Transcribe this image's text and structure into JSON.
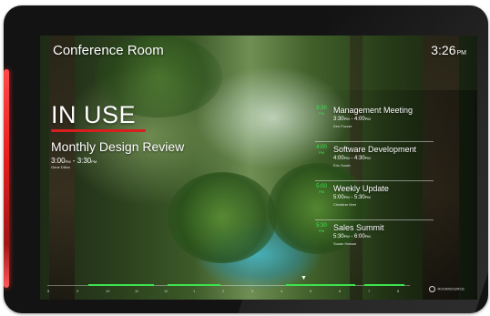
{
  "room": {
    "name": "Conference Room"
  },
  "clock": {
    "time": "3:26",
    "ampm": "PM"
  },
  "status": {
    "label": "IN USE",
    "color": "#d81e1e"
  },
  "current_meeting": {
    "title": "Monthly Design Review",
    "start": "3:00",
    "start_ampm": "PM",
    "end": "3:30",
    "end_ampm": "PM",
    "host": "Gene Dillon"
  },
  "agenda": [
    {
      "badge_line1": "PM",
      "badge_num": "3:30",
      "title": "Management Meeting",
      "start": "3:30",
      "start_ampm": "PM",
      "end": "4:00",
      "end_ampm": "PM",
      "host": "Ken Fozzer"
    },
    {
      "badge_line1": "PM",
      "badge_num": "4:00",
      "title": "Software Development",
      "start": "4:00",
      "start_ampm": "PM",
      "end": "4:30",
      "end_ampm": "PM",
      "host": "Eric Sorah"
    },
    {
      "badge_line1": "PM",
      "badge_num": "5:00",
      "title": "Weekly Update",
      "start": "5:00",
      "start_ampm": "PM",
      "end": "5:30",
      "end_ampm": "PM",
      "host": "Christina Veer"
    },
    {
      "badge_line1": "PM",
      "badge_num": "5:30",
      "title": "Sales Summit",
      "start": "5:30",
      "start_ampm": "PM",
      "end": "6:00",
      "end_ampm": "PM",
      "host": "Susan Hassar"
    }
  ],
  "timeline": {
    "ticks": [
      "8",
      "9",
      "10",
      "11",
      "12",
      "1",
      "2",
      "3",
      "4",
      "5",
      "6",
      "7",
      "8"
    ],
    "accent": "#3de24f"
  },
  "brand": {
    "name": "ROOMSOURCE"
  },
  "colors": {
    "led": "#e61f1f",
    "accent_green": "#3de24f"
  }
}
